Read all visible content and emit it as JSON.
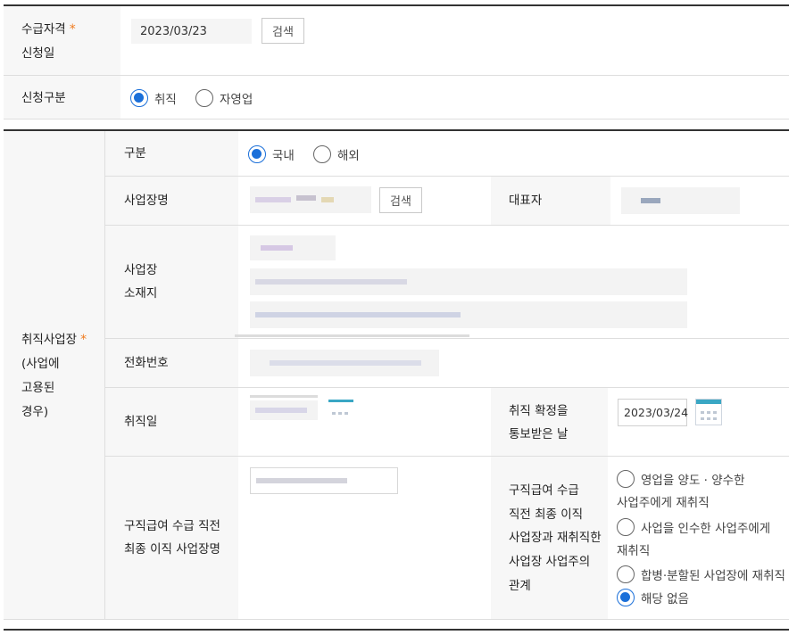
{
  "form": {
    "apply_date_label_1": "수급자격",
    "apply_date_label_2": "신청일",
    "required_mark": "*",
    "apply_date_value": "2023/03/23",
    "search_label": "검색",
    "apply_type_label": "신청구분",
    "apply_type_options": [
      "취직",
      "자영업"
    ],
    "apply_type_selected": "취직"
  },
  "employer": {
    "section_label_1": "취직사업장",
    "section_label_2": "(사업에",
    "section_label_3": "고용된",
    "section_label_4": "경우)",
    "division_label": "구분",
    "division_options": [
      "국내",
      "해외"
    ],
    "division_selected": "국내",
    "biz_name_label": "사업장명",
    "search_label": "검색",
    "ceo_label": "대표자",
    "address_label_1": "사업장",
    "address_label_2": "소재지",
    "phone_label": "전화번호",
    "hire_date_label": "취직일",
    "confirm_date_label_1": "취직 확정을",
    "confirm_date_label_2": "통보받은 날",
    "confirm_date_value": "2023/03/24",
    "last_biz_label_1": "구직급여 수급 직전",
    "last_biz_label_2": "최종 이직 사업장명",
    "relation_label_1": "구직급여 수급",
    "relation_label_2": "직전 최종 이직",
    "relation_label_3": "사업장과 재취직한",
    "relation_label_4": "사업장 사업주의",
    "relation_label_5": "관계",
    "relation_options": {
      "opt1_line1": "영업을 양도 · 양수한",
      "opt1_line2": "사업주에게 재취직",
      "opt2_line1": "사업을 인수한 사업주에게",
      "opt2_line2": "재취직",
      "opt3": "합병·분할된 사업장에 재취직",
      "opt4": "해당 없음"
    },
    "relation_selected": "해당 없음"
  },
  "colors": {
    "accent": "#1a6fd9",
    "required": "#f07b1e",
    "label_bg": "#f7f7f7"
  }
}
